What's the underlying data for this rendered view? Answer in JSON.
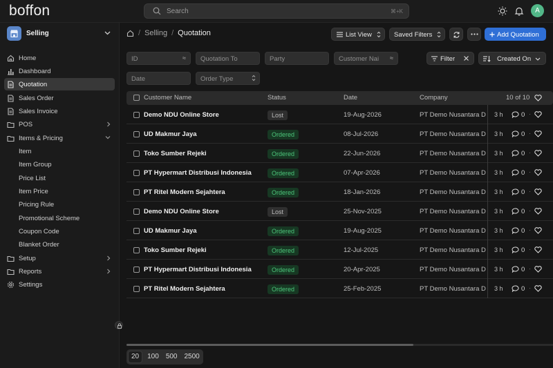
{
  "app": {
    "logo": "boffon"
  },
  "topbar": {
    "search_placeholder": "Search",
    "search_shortcut": "⌘+K",
    "avatar_initial": "A",
    "colors": {
      "avatar": "#52b788",
      "primary": "#2f6fd6"
    }
  },
  "sidebar": {
    "workspace": "Selling",
    "items": [
      {
        "label": "Home",
        "icon": "home-icon"
      },
      {
        "label": "Dashboard",
        "icon": "bar-chart-icon"
      },
      {
        "label": "Quotation",
        "icon": "document-icon"
      },
      {
        "label": "Sales Order",
        "icon": "document-icon"
      },
      {
        "label": "Sales Invoice",
        "icon": "document-icon"
      },
      {
        "label": "POS",
        "icon": "folder-icon"
      },
      {
        "label": "Items & Pricing",
        "icon": "folder-icon"
      },
      {
        "label": "Item"
      },
      {
        "label": "Item Group"
      },
      {
        "label": "Price List"
      },
      {
        "label": "Item Price"
      },
      {
        "label": "Pricing Rule"
      },
      {
        "label": "Promotional Scheme"
      },
      {
        "label": "Coupon Code"
      },
      {
        "label": "Blanket Order"
      },
      {
        "label": "Setup",
        "icon": "folder-icon"
      },
      {
        "label": "Reports",
        "icon": "folder-icon"
      },
      {
        "label": "Settings",
        "icon": "gear-icon"
      }
    ]
  },
  "breadcrumb": {
    "parent": "Selling",
    "current": "Quotation",
    "separator": "/"
  },
  "toolbar": {
    "list_view": "List View",
    "saved_filters": "Saved Filters",
    "add_button": "Add Quotation"
  },
  "filters": {
    "id_placeholder": "ID",
    "quotation_to_placeholder": "Quotation To",
    "party_placeholder": "Party",
    "customer_name_placeholder": "Customer Nai",
    "date_placeholder": "Date",
    "order_type_placeholder": "Order Type",
    "filter_label": "Filter",
    "sort_label": "Created On",
    "approx_symbol": "≈"
  },
  "table": {
    "headers": {
      "customer": "Customer Name",
      "status": "Status",
      "date": "Date",
      "company": "Company",
      "count": "10 of 10"
    },
    "rows": [
      {
        "customer": "Demo NDU Online Store",
        "status": "Lost",
        "date": "19-Aug-2026",
        "company": "PT Demo Nusantara D",
        "ago": "3 h",
        "comments": "0"
      },
      {
        "customer": "UD Makmur Jaya",
        "status": "Ordered",
        "date": "08-Jul-2026",
        "company": "PT Demo Nusantara D",
        "ago": "3 h",
        "comments": "0"
      },
      {
        "customer": "Toko Sumber Rejeki",
        "status": "Ordered",
        "date": "22-Jun-2026",
        "company": "PT Demo Nusantara D",
        "ago": "3 h",
        "comments": "0"
      },
      {
        "customer": "PT Hypermart Distribusi Indonesia",
        "status": "Ordered",
        "date": "07-Apr-2026",
        "company": "PT Demo Nusantara D",
        "ago": "3 h",
        "comments": "0"
      },
      {
        "customer": "PT Ritel Modern Sejahtera",
        "status": "Ordered",
        "date": "18-Jan-2026",
        "company": "PT Demo Nusantara D",
        "ago": "3 h",
        "comments": "0"
      },
      {
        "customer": "Demo NDU Online Store",
        "status": "Lost",
        "date": "25-Nov-2025",
        "company": "PT Demo Nusantara D",
        "ago": "3 h",
        "comments": "0"
      },
      {
        "customer": "UD Makmur Jaya",
        "status": "Ordered",
        "date": "19-Aug-2025",
        "company": "PT Demo Nusantara D",
        "ago": "3 h",
        "comments": "0"
      },
      {
        "customer": "Toko Sumber Rejeki",
        "status": "Ordered",
        "date": "12-Jul-2025",
        "company": "PT Demo Nusantara D",
        "ago": "3 h",
        "comments": "0"
      },
      {
        "customer": "PT Hypermart Distribusi Indonesia",
        "status": "Ordered",
        "date": "20-Apr-2025",
        "company": "PT Demo Nusantara D",
        "ago": "3 h",
        "comments": "0"
      },
      {
        "customer": "PT Ritel Modern Sejahtera",
        "status": "Ordered",
        "date": "25-Feb-2025",
        "company": "PT Demo Nusantara D",
        "ago": "3 h",
        "comments": "0"
      }
    ]
  },
  "pagination": {
    "sizes": [
      "20",
      "100",
      "500",
      "2500"
    ],
    "selected": "20"
  }
}
